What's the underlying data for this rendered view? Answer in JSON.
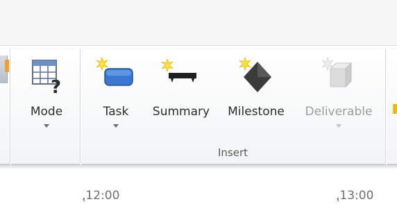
{
  "ribbon": {
    "buttons": {
      "mode": {
        "label": "Mode",
        "icon": "calendar-question-icon"
      },
      "task": {
        "label": "Task",
        "icon": "task-bar-icon"
      },
      "summary": {
        "label": "Summary",
        "icon": "summary-bar-icon"
      },
      "milestone": {
        "label": "Milestone",
        "icon": "milestone-diamond-icon"
      },
      "deliverable": {
        "label": "Deliverable",
        "icon": "deliverable-cube-icon",
        "disabled": true
      }
    },
    "groups": {
      "insert": "Insert"
    }
  },
  "timescale": {
    "labels": [
      ",12:00",
      ",13:00"
    ]
  },
  "colors": {
    "task_blue": "#3a78d4",
    "starburst": "#ffe23a",
    "milestone": "#3b3b3b",
    "disabled_text": "#9c9c9c",
    "accent_orange": "#f0a030"
  }
}
